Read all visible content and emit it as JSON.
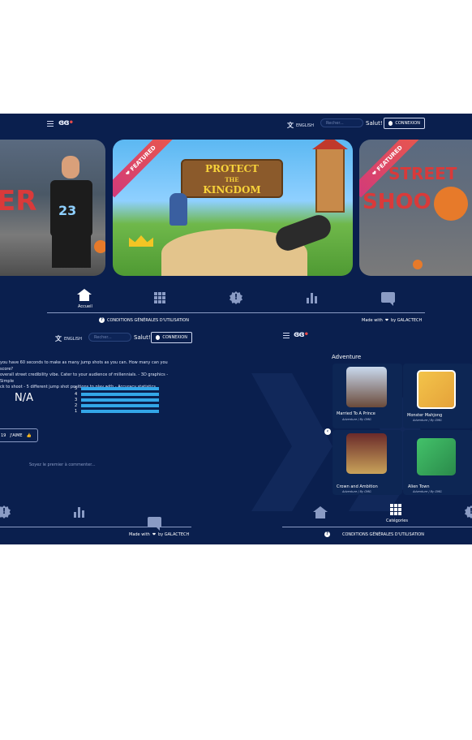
{
  "header": {
    "lang_label": "ENGLISH",
    "search_placeholder": "Recher...",
    "greeting": "Salut!",
    "login_label": "CONNEXION"
  },
  "carousel": {
    "featured_label": "FEATURED",
    "center_title_line1": "PROTECT",
    "center_title_line2": "THE",
    "center_title_line3": "KINGDOM",
    "left_graffiti": "ER",
    "left_jersey_number": "23",
    "right_graffiti_1": "STREET",
    "right_graffiti_2": "SHOO"
  },
  "nav": {
    "home_label": "Accueil",
    "categories_label": "Catégories"
  },
  "footer": {
    "terms_label": "CONDITIONS GÉNÉRALES D'UTILISATION",
    "made_with_prefix": "Made with",
    "made_with_suffix": "by GALACTECH"
  },
  "detail": {
    "description_line1": "you have 60 seconds to make as many jump shots as you can. How many can you score?",
    "description_line2": "overall street credibility vibe. Cater to your audience of millennials. - 3D graphics - Simple",
    "description_line3": "ck to shoot - 5 different jump shot positions to play with - Accuracy statistics",
    "rating_value": "N/A",
    "rating_levels": [
      "5",
      "4",
      "3",
      "2",
      "1"
    ],
    "like_count": "19",
    "like_label": "J'AIME",
    "first_comment": "Soyez le premier à commenter..."
  },
  "category": {
    "title": "Adventure",
    "games": [
      {
        "name": "Married To A Prince",
        "meta": "Adventure / By OMG"
      },
      {
        "name": "Monster Mahjong",
        "meta": "Adventure / By OMG"
      },
      {
        "name": "Crown and Ambition",
        "meta": "Adventure / By OMG"
      },
      {
        "name": "Alien Town",
        "meta": "Adventure / By OMG"
      }
    ]
  },
  "colors": {
    "background": "#0a1f4e",
    "accent_blue": "#33a6e8",
    "featured_ribbon": "#d23a7a"
  },
  "icons": [
    "menu-icon",
    "translate-icon",
    "user-icon",
    "home-icon",
    "grid-icon",
    "badge-icon",
    "bar-chart-icon",
    "chat-icon",
    "help-icon",
    "heart-icon",
    "thumbs-up-icon",
    "chevron-left-icon"
  ]
}
